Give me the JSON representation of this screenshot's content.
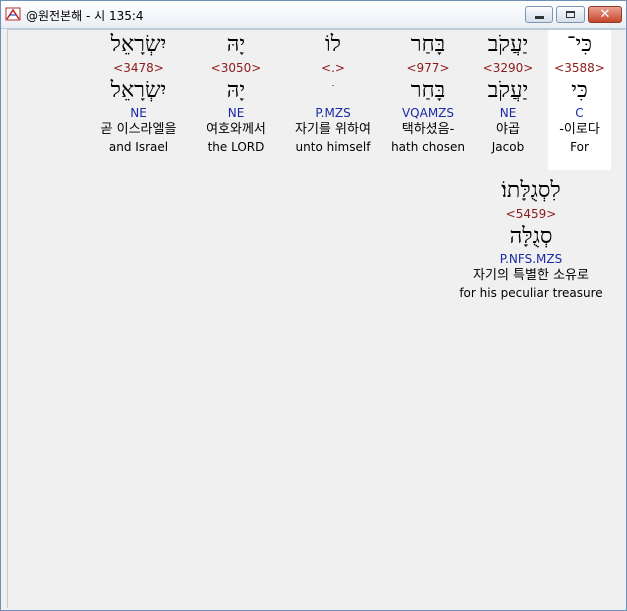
{
  "window": {
    "title": "@원전본해 - 시 135:4"
  },
  "row1": [
    {
      "hebrew": "כִּי־",
      "strong": "<3588>",
      "hebrew_root": "כִּי",
      "morph": "C",
      "korean": "-이로다",
      "english": "For"
    },
    {
      "hebrew": "יַעֲקֹב",
      "strong": "<3290>",
      "hebrew_root": "יַעֲקֹב",
      "morph": "NE",
      "korean": "야곱",
      "english": "Jacob"
    },
    {
      "hebrew": "בָּחַר",
      "strong": "<977>",
      "hebrew_root": "בָּחַר",
      "morph": "VQAMZS",
      "korean": "택하셨음-",
      "english": "hath chosen"
    },
    {
      "hebrew": "לוֹ",
      "strong": "<.>",
      "hebrew_root": "ׁ",
      "morph": "P.MZS",
      "korean": "자기를 위하여",
      "english": "unto himself"
    },
    {
      "hebrew": "יָהּ",
      "strong": "<3050>",
      "hebrew_root": "יָהּ",
      "morph": "NE",
      "korean": "여호와께서",
      "english": "the LORD"
    },
    {
      "hebrew": "יִשְׂרָאֵל",
      "strong": "<3478>",
      "hebrew_root": "יִשְׂרָאֵל",
      "morph": "NE",
      "korean": "곧 이스라엘을",
      "english": "and Israel"
    }
  ],
  "row2": [
    {
      "hebrew": "לִסְגֻלָּתוֹ׃",
      "strong": "<5459>",
      "hebrew_root": "סְגֻלָּה",
      "morph": "P.NFS.MZS",
      "korean": "자기의 특별한 소유로",
      "english": "for his peculiar treasure"
    }
  ]
}
